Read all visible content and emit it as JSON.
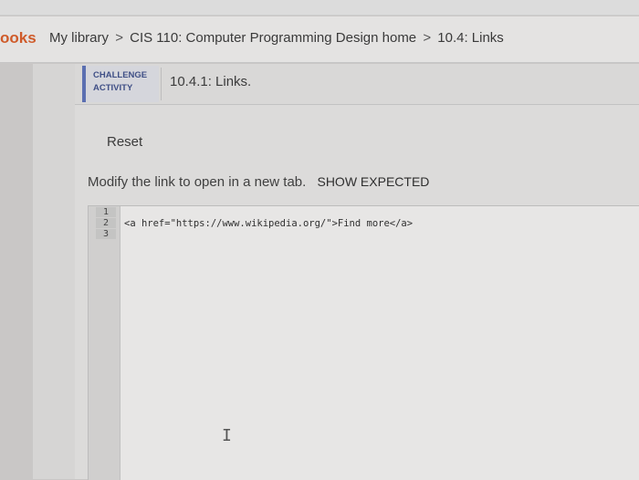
{
  "header": {
    "brand": "ooks",
    "breadcrumbs": [
      {
        "label": "My library"
      },
      {
        "label": "CIS 110: Computer Programming Design home"
      },
      {
        "label": "10.4: Links"
      }
    ],
    "separator": ">"
  },
  "activity": {
    "type_label_line1": "CHALLENGE",
    "type_label_line2": "ACTIVITY",
    "title": "10.4.1: Links."
  },
  "controls": {
    "reset_label": "Reset",
    "instruction": "Modify the link to open in a new tab.",
    "show_expected_label": "SHOW EXPECTED"
  },
  "editor": {
    "line_numbers": [
      "1",
      "2",
      "3"
    ],
    "lines": [
      "",
      "<a href=\"https://www.wikipedia.org/\">Find more</a>",
      ""
    ]
  },
  "colors": {
    "brand": "#cf5b2a",
    "challenge_accent": "#5b6fb1"
  },
  "icons": {
    "cursor": "text-cursor-icon"
  }
}
